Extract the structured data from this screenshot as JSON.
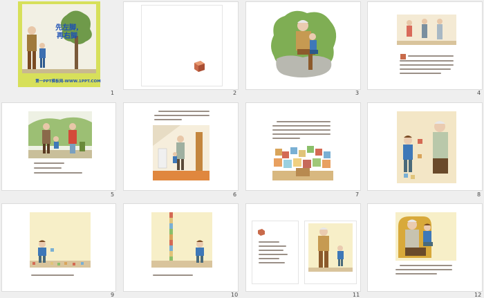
{
  "cover": {
    "title_line1": "先左脚,",
    "title_line2": "再右脚",
    "footer": "第一PPT模板网-WWW.1PPT.COM"
  },
  "slides": [
    {
      "num": "1"
    },
    {
      "num": "2"
    },
    {
      "num": "3"
    },
    {
      "num": "4"
    },
    {
      "num": "5"
    },
    {
      "num": "6"
    },
    {
      "num": "7"
    },
    {
      "num": "8"
    },
    {
      "num": "9"
    },
    {
      "num": "10"
    },
    {
      "num": "11"
    },
    {
      "num": "12"
    }
  ]
}
